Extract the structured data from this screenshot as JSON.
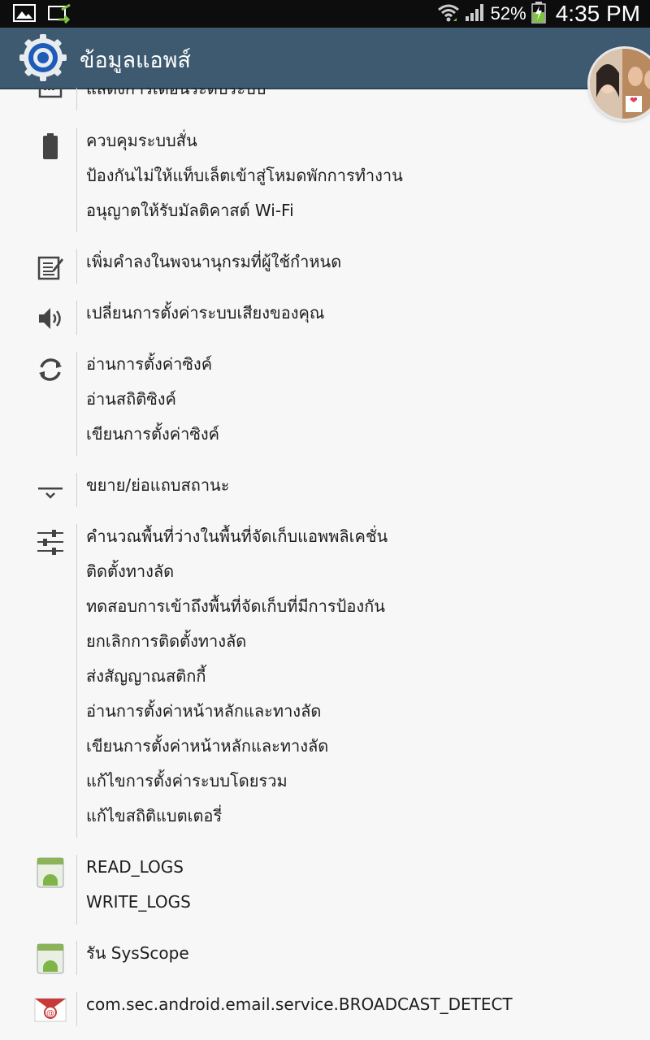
{
  "status_bar": {
    "battery_percent": "52%",
    "time": "4:35 PM",
    "icons": [
      "gallery-icon",
      "sync-icon",
      "wifi-icon",
      "signal-icon",
      "battery-charging-icon"
    ]
  },
  "action_bar": {
    "title": "ข้อมูลแอพส์",
    "icon": "settings-gear-icon"
  },
  "permission_groups": [
    {
      "icon": "notification-icon",
      "items": [
        "แสดงการเตือนระดับระบบ"
      ]
    },
    {
      "icon": "battery-icon",
      "items": [
        "ควบคุมระบบสั่น",
        "ป้องกันไม่ให้แท็บเล็ตเข้าสู่โหมดพักการทำงาน",
        "อนุญาตให้รับมัลติคาสต์ Wi-Fi"
      ]
    },
    {
      "icon": "edit-note-icon",
      "items": [
        "เพิ่มคำลงในพจนานุกรมที่ผู้ใช้กำหนด"
      ]
    },
    {
      "icon": "volume-icon",
      "items": [
        "เปลี่ยนการตั้งค่าระบบเสียงของคุณ"
      ]
    },
    {
      "icon": "sync-icon",
      "items": [
        "อ่านการตั้งค่าซิงค์",
        "อ่านสถิติซิงค์",
        "เขียนการตั้งค่าซิงค์"
      ]
    },
    {
      "icon": "status-bar-expand-icon",
      "items": [
        "ขยาย/ย่อแถบสถานะ"
      ]
    },
    {
      "icon": "sliders-icon",
      "items": [
        "คำนวณพื้นที่ว่างในพื้นที่จัดเก็บแอพพลิเคชั่น",
        "ติดตั้งทางลัด",
        "ทดสอบการเข้าถึงพื้นที่จัดเก็บที่มีการป้องกัน",
        "ยกเลิกการติดตั้งทางลัด",
        "ส่งสัญญาณสติกกี้",
        "อ่านการตั้งค่าหน้าหลักและทางลัด",
        "เขียนการตั้งค่าหน้าหลักและทางลัด",
        "แก้ไขการตั้งค่าระบบโดยรวม",
        "แก้ไขสถิติแบตเตอรี่"
      ]
    },
    {
      "icon": "android-app-icon",
      "items": [
        "READ_LOGS",
        "WRITE_LOGS"
      ]
    },
    {
      "icon": "android-app-icon",
      "items": [
        "รัน SysScope"
      ]
    },
    {
      "icon": "email-icon",
      "items": [
        "com.sec.android.email.service.BROADCAST_DETECT"
      ]
    }
  ]
}
